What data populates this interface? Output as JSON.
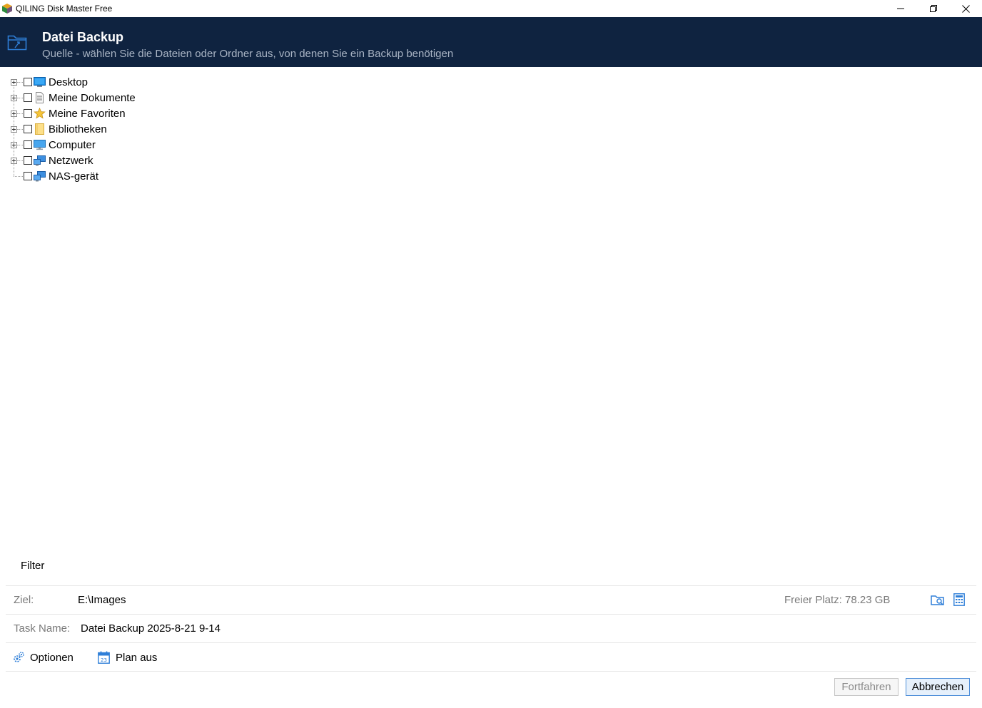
{
  "window": {
    "title": "QILING Disk Master Free"
  },
  "header": {
    "title": "Datei Backup",
    "subtitle": "Quelle - wählen Sie die Dateien oder Ordner aus, von denen Sie ein Backup benötigen"
  },
  "tree": {
    "items": [
      {
        "label": "Desktop",
        "icon": "desktop-icon",
        "expandable": true,
        "checked": false
      },
      {
        "label": "Meine Dokumente",
        "icon": "document-icon",
        "expandable": true,
        "checked": false
      },
      {
        "label": "Meine Favoriten",
        "icon": "star-icon",
        "expandable": true,
        "checked": false
      },
      {
        "label": "Bibliotheken",
        "icon": "folder-icon",
        "expandable": true,
        "checked": false
      },
      {
        "label": "Computer",
        "icon": "computer-icon",
        "expandable": true,
        "checked": false
      },
      {
        "label": "Netzwerk",
        "icon": "network-icon",
        "expandable": true,
        "checked": false
      },
      {
        "label": "NAS-gerät",
        "icon": "nas-icon",
        "expandable": false,
        "checked": false
      }
    ]
  },
  "filter": {
    "label": "Filter"
  },
  "destination": {
    "label": "Ziel:",
    "value": "E:\\Images",
    "free_space": "Freier Platz: 78.23 GB"
  },
  "task": {
    "label": "Task Name:",
    "value": "Datei Backup 2025-8-21 9-14"
  },
  "actions": {
    "options_label": "Optionen",
    "schedule_label": "Plan aus"
  },
  "buttons": {
    "continue_label": "Fortfahren",
    "cancel_label": "Abbrechen"
  },
  "colors": {
    "header_bg": "#0f2340",
    "accent": "#2f7fd8"
  }
}
